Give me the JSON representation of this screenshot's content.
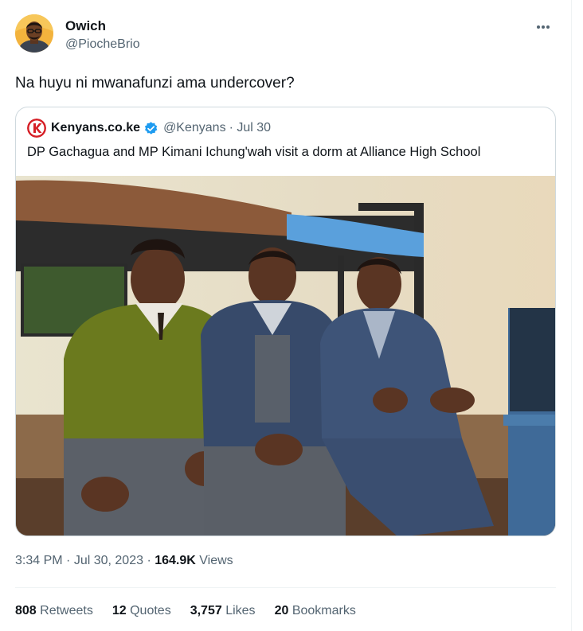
{
  "author": {
    "display_name": "Owich",
    "handle": "@PiocheBrio",
    "avatar_icon": "profile-avatar"
  },
  "tweet": {
    "text": "Na huyu ni mwanafunzi ama undercover?"
  },
  "quoted": {
    "name": "Kenyans.co.ke",
    "handle": "@Kenyans",
    "date": "· Jul 30",
    "text": "DP Gachagua and MP Kimani Ichung'wah visit a dorm at Alliance High School",
    "logo_icon": "kenyans-k-logo",
    "verified_icon": "verified-badge-icon"
  },
  "meta": {
    "time": "3:34 PM",
    "sep1": " · ",
    "date": "Jul 30, 2023",
    "sep2": " · ",
    "views_count": "164.9K",
    "views_label": " Views"
  },
  "stats": {
    "retweets": {
      "count": "808",
      "label": "Retweets"
    },
    "quotes": {
      "count": "12",
      "label": "Quotes"
    },
    "likes": {
      "count": "3,757",
      "label": "Likes"
    },
    "bookmarks": {
      "count": "20",
      "label": "Bookmarks"
    }
  },
  "colors": {
    "text_primary": "#0f1419",
    "text_secondary": "#536471",
    "border": "#cfd9de",
    "verified": "#1d9bf0",
    "kenyans_red": "#d62027"
  }
}
